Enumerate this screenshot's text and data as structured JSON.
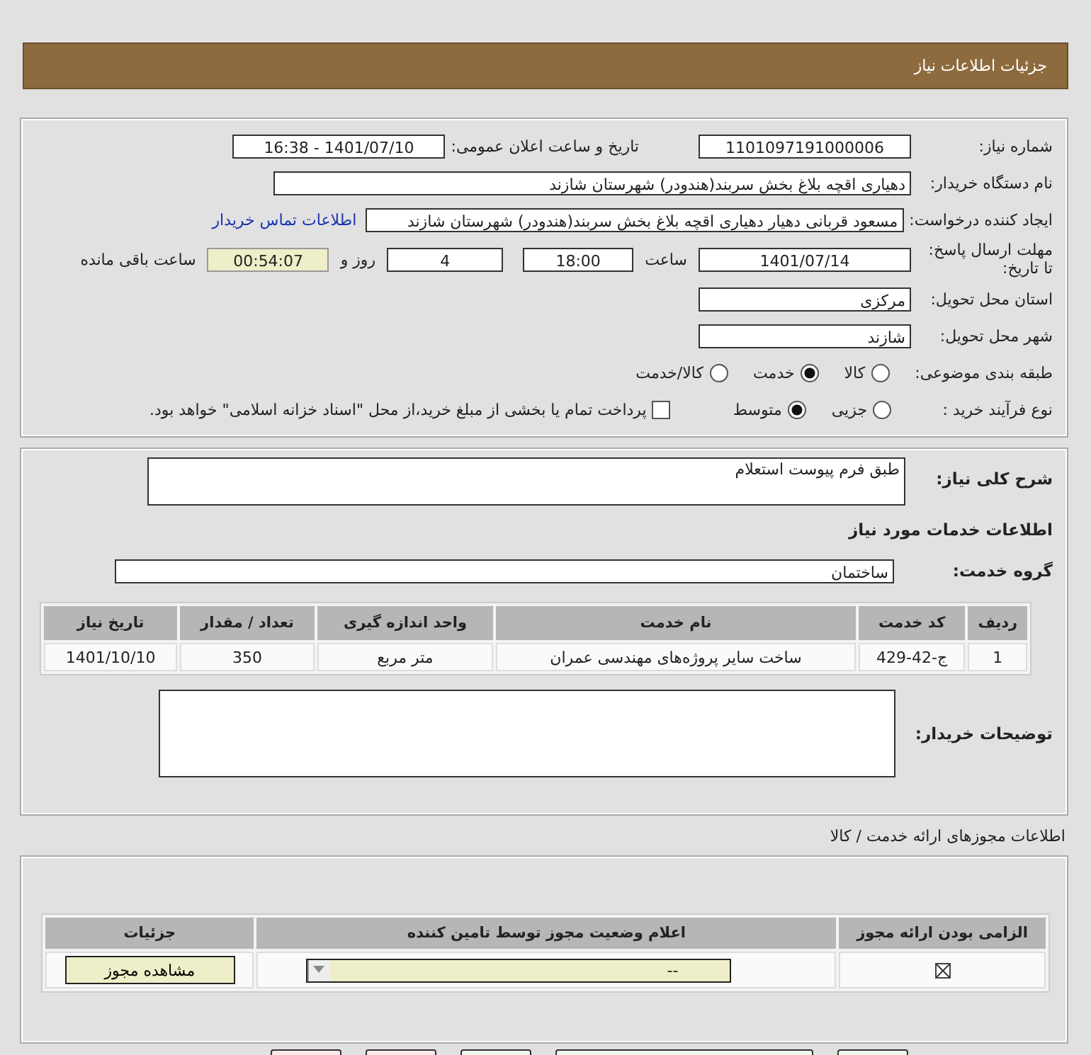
{
  "header": {
    "title": "جزئیات اطلاعات نیاز"
  },
  "details": {
    "need_number": {
      "label": "شماره نیاز:",
      "value": "1101097191000006"
    },
    "announce": {
      "label": "تاریخ و ساعت اعلان عمومی:",
      "value": "1401/07/10 - 16:38"
    },
    "buyer_org": {
      "label": "نام دستگاه خریدار:",
      "value": "دهیاری اقچه بلاغ بخش سربند(هندودر) شهرستان شازند"
    },
    "requester": {
      "label": "ایجاد کننده درخواست:",
      "value": "مسعود قربانی دهیار  دهیاری اقچه بلاغ بخش سربند(هندودر) شهرستان شازند",
      "link": "اطلاعات تماس خریدار"
    },
    "deadline": {
      "label": "مهلت ارسال پاسخ: تا تاریخ:",
      "date": "1401/07/14",
      "time_label": "ساعت",
      "time": "18:00",
      "days": "4",
      "days_label": "روز و",
      "remaining": "00:54:07",
      "remaining_label": "ساعت باقی مانده"
    },
    "province": {
      "label": "استان محل تحویل:",
      "value": "مرکزی"
    },
    "city": {
      "label": "شهر محل تحویل:",
      "value": "شازند"
    },
    "category": {
      "label": "طبقه بندی موضوعی:",
      "options": [
        {
          "label": "کالا",
          "selected": false
        },
        {
          "label": "خدمت",
          "selected": true
        },
        {
          "label": "کالا/خدمت",
          "selected": false
        }
      ]
    },
    "process": {
      "label": "نوع فرآیند خرید :",
      "options": [
        {
          "label": "جزیی",
          "selected": false
        },
        {
          "label": "متوسط",
          "selected": true
        }
      ],
      "payment": {
        "label": "پرداخت تمام یا بخشی از مبلغ خرید،از محل \"اسناد خزانه اسلامی\" خواهد بود.",
        "checked": false
      }
    }
  },
  "services": {
    "description": {
      "label": "شرح کلی نیاز:",
      "value": "طبق فرم پیوست استعلام"
    },
    "section_title": "اطلاعات خدمات مورد نیاز",
    "group": {
      "label": "گروه خدمت:",
      "value": "ساختمان"
    },
    "table": {
      "columns": [
        "ردیف",
        "کد خدمت",
        "نام خدمت",
        "واحد اندازه گیری",
        "تعداد / مقدار",
        "تاریخ نیاز"
      ],
      "rows": [
        [
          "1",
          "ج-42-429",
          "ساخت سایر پروژه‌های مهندسی عمران",
          "متر مربع",
          "350",
          "1401/10/10"
        ]
      ]
    },
    "buyer_notes": {
      "label": "توضیحات خریدار:"
    }
  },
  "licenses": {
    "title": "اطلاعات مجوزهای ارائه خدمت / کالا",
    "columns": [
      "الزامی بودن ارائه مجوز",
      "اعلام وضعیت مجوز توسط تامین کننده",
      "جزئیات"
    ],
    "rows": [
      {
        "required": true,
        "status": "--",
        "button": "مشاهده مجوز"
      }
    ]
  },
  "footer_buttons": [
    {
      "kind": "confirm"
    },
    {
      "kind": "confirm-wide"
    },
    {
      "kind": "confirm"
    },
    {
      "kind": "danger"
    },
    {
      "kind": "danger"
    }
  ]
}
